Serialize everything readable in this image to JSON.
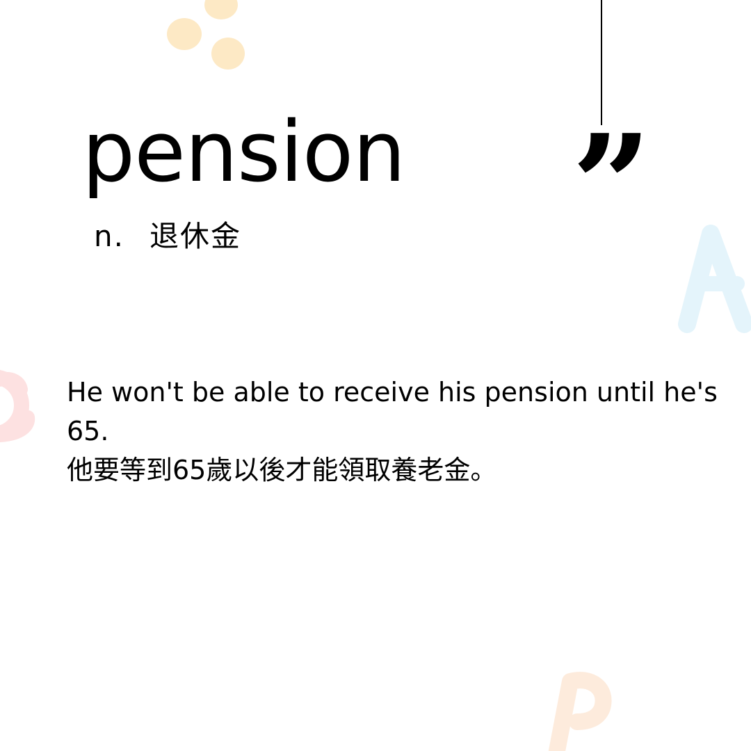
{
  "entry": {
    "word": "pension",
    "part_of_speech": "n.",
    "translation": "退休金"
  },
  "example": {
    "english": "He won't be able to receive his pension until he's 65.",
    "chinese": "他要等到65歲以後才能領取養老金。"
  },
  "decor": {
    "quote_glyph": "”",
    "colors": {
      "dots": "#fde9c5",
      "letter_a": "#e4f4fb",
      "letter_c": "#fde1e1",
      "letter_b": "#fdebdc"
    }
  }
}
